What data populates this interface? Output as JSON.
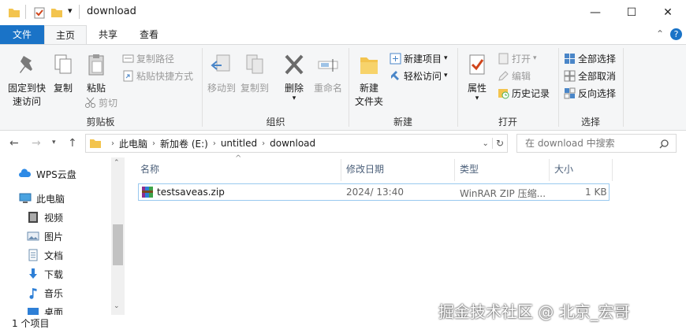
{
  "window": {
    "title": "download",
    "minimize": "—",
    "maximize": "☐",
    "close": "✕",
    "qat_dropdown": "▾"
  },
  "ribbon_tabs": {
    "file": "文件",
    "home": "主页",
    "share": "共享",
    "view": "查看",
    "collapse": "⌃",
    "help": "?"
  },
  "ribbon": {
    "clipboard": {
      "label": "剪贴板",
      "pin_line1": "固定到快",
      "pin_line2": "速访问",
      "copy": "复制",
      "paste": "粘贴",
      "copy_path": "复制路径",
      "paste_shortcut": "粘贴快捷方式",
      "cut": "剪切"
    },
    "organize": {
      "label": "组织",
      "move_to": "移动到",
      "copy_to": "复制到",
      "delete": "删除",
      "rename": "重命名"
    },
    "new": {
      "label": "新建",
      "new_folder_line1": "新建",
      "new_folder_line2": "文件夹",
      "new_item": "新建项目",
      "easy_access": "轻松访问"
    },
    "open": {
      "label": "打开",
      "properties": "属性",
      "open": "打开",
      "edit": "编辑",
      "history": "历史记录"
    },
    "select": {
      "label": "选择",
      "select_all": "全部选择",
      "select_none": "全部取消",
      "invert": "反向选择"
    }
  },
  "address": {
    "crumbs": [
      "此电脑",
      "新加卷 (E:)",
      "untitled",
      "download"
    ],
    "search_placeholder": "在 download 中搜索"
  },
  "nav_pane": {
    "items": [
      {
        "label": "WPS云盘",
        "icon": "cloud-icon"
      },
      {
        "label": "此电脑",
        "icon": "computer-icon"
      },
      {
        "label": "视频",
        "icon": "video-icon"
      },
      {
        "label": "图片",
        "icon": "pictures-icon"
      },
      {
        "label": "文档",
        "icon": "documents-icon"
      },
      {
        "label": "下载",
        "icon": "download-icon"
      },
      {
        "label": "音乐",
        "icon": "music-icon"
      },
      {
        "label": "桌面",
        "icon": "desktop-icon"
      }
    ]
  },
  "file_list": {
    "columns": {
      "name": "名称",
      "modified": "修改日期",
      "type": "类型",
      "size": "大小"
    },
    "rows": [
      {
        "name": "testsaveas.zip",
        "modified": "2024/ 13:40",
        "type": "WinRAR ZIP 压缩...",
        "size": "1 KB"
      }
    ]
  },
  "status": {
    "count": "1 个项目"
  },
  "watermark": "掘金技术社区 @ 北京_宏哥",
  "colors": {
    "accent": "#1a73c7",
    "folder": "#f3c44e",
    "ribbon_bg": "#f5f6f7",
    "selection_border": "#99c9ef"
  }
}
